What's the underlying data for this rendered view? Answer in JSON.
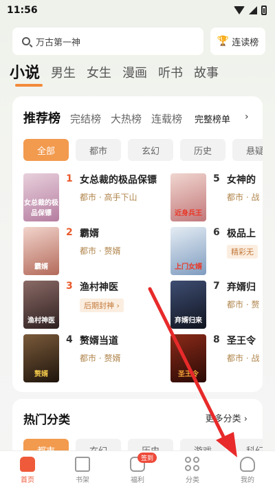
{
  "status": {
    "time": "11:56"
  },
  "search": {
    "placeholder": "万古第一神",
    "read_button": "连读榜"
  },
  "top_tabs": [
    "小说",
    "男生",
    "女生",
    "漫画",
    "听书",
    "故事"
  ],
  "ranking": {
    "tabs": [
      "推荐榜",
      "完结榜",
      "大热榜",
      "连载榜"
    ],
    "full_list": "完整榜单",
    "filters": [
      "全部",
      "都市",
      "玄幻",
      "历史",
      "悬疑"
    ],
    "books_left": [
      {
        "rank": "1",
        "title": "女总裁的极品保镖",
        "meta": "都市 · 高手下山",
        "cover_text": "女总裁的极品保镖",
        "color": "#c9a2b8"
      },
      {
        "rank": "2",
        "title": "霸婿",
        "meta": "都市 · 赘婿",
        "cover_text": "霸婿",
        "color": "#d8a8a0"
      },
      {
        "rank": "3",
        "title": "渔村神医",
        "tag": "后期封神 ›",
        "cover_text": "渔村神医",
        "color": "#6b4b48"
      },
      {
        "rank": "4",
        "title": "赘婿当道",
        "meta": "都市 · 赘婿",
        "cover_text": "赘婿",
        "color": "#4a3524"
      }
    ],
    "books_right": [
      {
        "rank": "5",
        "title": "女神的",
        "meta": "都市 · 战",
        "cover_text": "近身兵王",
        "color": "#c8a6a0"
      },
      {
        "rank": "6",
        "title": "极品上",
        "tag": "精彩无",
        "cover_text": "上门女婿",
        "color": "#b8c8dc"
      },
      {
        "rank": "7",
        "title": "弃婿归",
        "meta": "都市 · 赘",
        "cover_text": "弃婿归来",
        "color": "#2f3a55"
      },
      {
        "rank": "8",
        "title": "圣王令",
        "meta": "都市 · 战",
        "cover_text": "圣王令",
        "color": "#6a2418"
      }
    ]
  },
  "hot": {
    "title": "热门分类",
    "more": "更多分类 ›",
    "chips": [
      "都市",
      "玄幻",
      "历史",
      "游戏",
      "科幻"
    ]
  },
  "nav": {
    "items": [
      "首页",
      "书架",
      "福利",
      "分类",
      "我的"
    ],
    "badge": "签到"
  },
  "colors": {
    "accent": "#f29a4e",
    "brand_red": "#ee5a3a",
    "arrow": "#e82a2a"
  }
}
